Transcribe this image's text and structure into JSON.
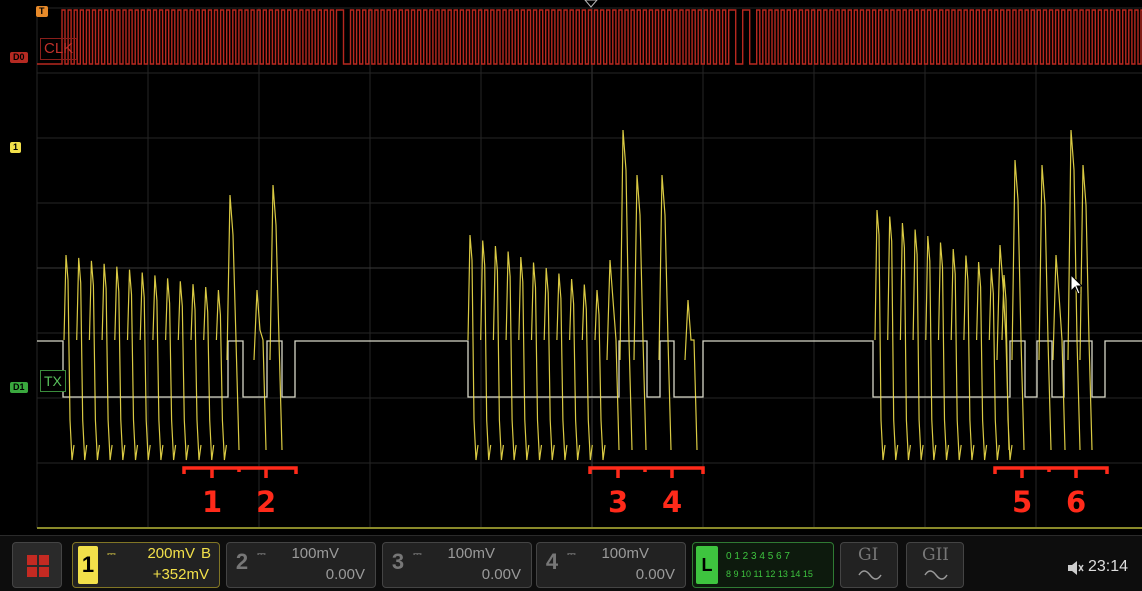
{
  "channels": {
    "clk": {
      "name": "CLK",
      "color": "#c0302a"
    },
    "tx": {
      "name": "TX",
      "color": "#58c15b"
    },
    "ch1": {
      "color": "#f2e04a"
    }
  },
  "markers": {
    "trigger": "T",
    "d0": "D0",
    "ch1": "1",
    "d1": "D1"
  },
  "annotations": [
    "1",
    "2",
    "3",
    "4",
    "5",
    "6"
  ],
  "bottom_bar": {
    "ch1": {
      "number": "1",
      "scale": "200mV",
      "bw": "B",
      "offset": "+352mV"
    },
    "ch2": {
      "number": "2",
      "scale": "100mV",
      "offset": "0.00V"
    },
    "ch3": {
      "number": "3",
      "scale": "100mV",
      "offset": "0.00V"
    },
    "ch4": {
      "number": "4",
      "scale": "100mV",
      "offset": "0.00V"
    },
    "logic": {
      "label": "L",
      "row1": "0 1 2 3  4 5 6 7",
      "row2": "8 9 10 11 12 13 14 15"
    },
    "gen1": {
      "label": "GI"
    },
    "gen2": {
      "label": "GII"
    },
    "clock": "23:14"
  }
}
